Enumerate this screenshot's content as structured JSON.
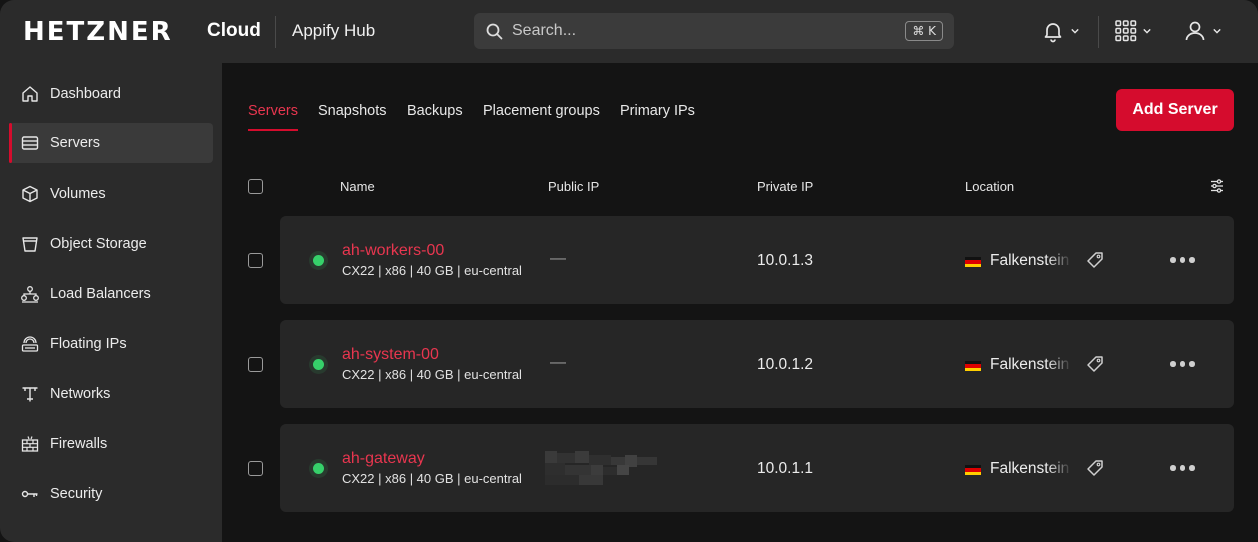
{
  "header": {
    "brand": "HETZNER",
    "brand_sub": "Cloud",
    "project": "Appify Hub",
    "search": {
      "placeholder": "Search...",
      "shortcut": "⌘ K"
    },
    "icons": [
      "bell-icon",
      "apps-grid-icon",
      "user-icon"
    ]
  },
  "sidebar": {
    "items": [
      {
        "label": "Dashboard",
        "icon": "home-icon",
        "active": false
      },
      {
        "label": "Servers",
        "icon": "server-icon",
        "active": true
      },
      {
        "label": "Volumes",
        "icon": "cube-icon",
        "active": false
      },
      {
        "label": "Object Storage",
        "icon": "bucket-icon",
        "active": false
      },
      {
        "label": "Load Balancers",
        "icon": "load-balancer-icon",
        "active": false
      },
      {
        "label": "Floating IPs",
        "icon": "floating-ip-icon",
        "active": false
      },
      {
        "label": "Networks",
        "icon": "network-icon",
        "active": false
      },
      {
        "label": "Firewalls",
        "icon": "firewall-icon",
        "active": false
      },
      {
        "label": "Security",
        "icon": "key-icon",
        "active": false
      }
    ]
  },
  "tabs": [
    {
      "label": "Servers",
      "active": true
    },
    {
      "label": "Snapshots",
      "active": false
    },
    {
      "label": "Backups",
      "active": false
    },
    {
      "label": "Placement groups",
      "active": false
    },
    {
      "label": "Primary IPs",
      "active": false
    }
  ],
  "add_button": "Add Server",
  "table": {
    "columns": [
      "Name",
      "Public IP",
      "Private IP",
      "Location"
    ],
    "rows": [
      {
        "name": "ah-workers-00",
        "spec": "CX22 | x86 | 40 GB | eu-central",
        "public_ip": "—",
        "private_ip": "10.0.1.3",
        "location": "Falkenstein",
        "status": "running"
      },
      {
        "name": "ah-system-00",
        "spec": "CX22 | x86 | 40 GB | eu-central",
        "public_ip": "—",
        "private_ip": "10.0.1.2",
        "location": "Falkenstein",
        "status": "running"
      },
      {
        "name": "ah-gateway",
        "spec": "CX22 | x86 | 40 GB | eu-central",
        "public_ip": "",
        "private_ip": "10.0.1.1",
        "location": "Falkenstein",
        "status": "running"
      }
    ]
  },
  "colors": {
    "accent": "#d50c2d",
    "status_running": "#36d06a",
    "surface": "#2b2b2b",
    "background": "#141414"
  }
}
